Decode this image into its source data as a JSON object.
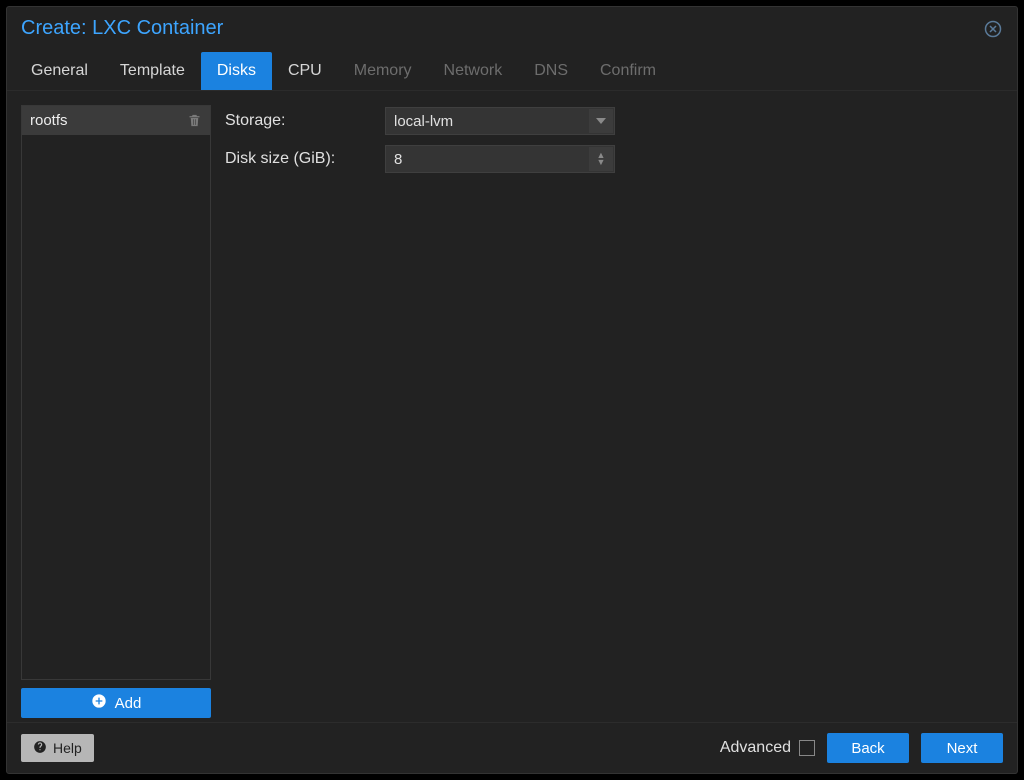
{
  "window": {
    "title": "Create: LXC Container"
  },
  "tabs": [
    {
      "label": "General",
      "active": false,
      "enabled": true
    },
    {
      "label": "Template",
      "active": false,
      "enabled": true
    },
    {
      "label": "Disks",
      "active": true,
      "enabled": true
    },
    {
      "label": "CPU",
      "active": false,
      "enabled": true
    },
    {
      "label": "Memory",
      "active": false,
      "enabled": false
    },
    {
      "label": "Network",
      "active": false,
      "enabled": false
    },
    {
      "label": "DNS",
      "active": false,
      "enabled": false
    },
    {
      "label": "Confirm",
      "active": false,
      "enabled": false
    }
  ],
  "disklist": {
    "items": [
      {
        "name": "rootfs",
        "deletable": true
      }
    ],
    "add_label": "Add"
  },
  "form": {
    "storage": {
      "label": "Storage:",
      "value": "local-lvm"
    },
    "size": {
      "label": "Disk size (GiB):",
      "value": "8"
    }
  },
  "footer": {
    "help_label": "Help",
    "advanced_label": "Advanced",
    "advanced_checked": false,
    "back_label": "Back",
    "next_label": "Next"
  }
}
